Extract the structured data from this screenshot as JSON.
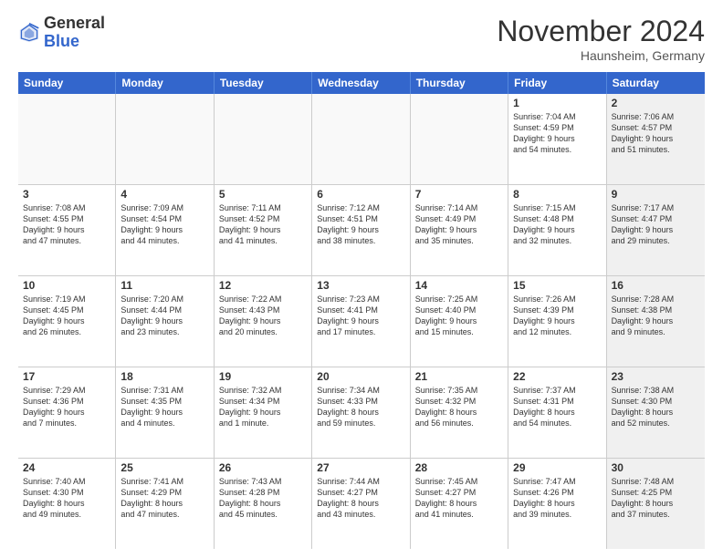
{
  "header": {
    "logo_general": "General",
    "logo_blue": "Blue",
    "month_title": "November 2024",
    "location": "Haunsheim, Germany"
  },
  "days_of_week": [
    "Sunday",
    "Monday",
    "Tuesday",
    "Wednesday",
    "Thursday",
    "Friday",
    "Saturday"
  ],
  "rows": [
    {
      "cells": [
        {
          "day": "",
          "info": "",
          "empty": true
        },
        {
          "day": "",
          "info": "",
          "empty": true
        },
        {
          "day": "",
          "info": "",
          "empty": true
        },
        {
          "day": "",
          "info": "",
          "empty": true
        },
        {
          "day": "",
          "info": "",
          "empty": true
        },
        {
          "day": "1",
          "info": "Sunrise: 7:04 AM\nSunset: 4:59 PM\nDaylight: 9 hours\nand 54 minutes.",
          "empty": false,
          "shaded": false
        },
        {
          "day": "2",
          "info": "Sunrise: 7:06 AM\nSunset: 4:57 PM\nDaylight: 9 hours\nand 51 minutes.",
          "empty": false,
          "shaded": true
        }
      ]
    },
    {
      "cells": [
        {
          "day": "3",
          "info": "Sunrise: 7:08 AM\nSunset: 4:55 PM\nDaylight: 9 hours\nand 47 minutes.",
          "empty": false,
          "shaded": false
        },
        {
          "day": "4",
          "info": "Sunrise: 7:09 AM\nSunset: 4:54 PM\nDaylight: 9 hours\nand 44 minutes.",
          "empty": false,
          "shaded": false
        },
        {
          "day": "5",
          "info": "Sunrise: 7:11 AM\nSunset: 4:52 PM\nDaylight: 9 hours\nand 41 minutes.",
          "empty": false,
          "shaded": false
        },
        {
          "day": "6",
          "info": "Sunrise: 7:12 AM\nSunset: 4:51 PM\nDaylight: 9 hours\nand 38 minutes.",
          "empty": false,
          "shaded": false
        },
        {
          "day": "7",
          "info": "Sunrise: 7:14 AM\nSunset: 4:49 PM\nDaylight: 9 hours\nand 35 minutes.",
          "empty": false,
          "shaded": false
        },
        {
          "day": "8",
          "info": "Sunrise: 7:15 AM\nSunset: 4:48 PM\nDaylight: 9 hours\nand 32 minutes.",
          "empty": false,
          "shaded": false
        },
        {
          "day": "9",
          "info": "Sunrise: 7:17 AM\nSunset: 4:47 PM\nDaylight: 9 hours\nand 29 minutes.",
          "empty": false,
          "shaded": true
        }
      ]
    },
    {
      "cells": [
        {
          "day": "10",
          "info": "Sunrise: 7:19 AM\nSunset: 4:45 PM\nDaylight: 9 hours\nand 26 minutes.",
          "empty": false,
          "shaded": false
        },
        {
          "day": "11",
          "info": "Sunrise: 7:20 AM\nSunset: 4:44 PM\nDaylight: 9 hours\nand 23 minutes.",
          "empty": false,
          "shaded": false
        },
        {
          "day": "12",
          "info": "Sunrise: 7:22 AM\nSunset: 4:43 PM\nDaylight: 9 hours\nand 20 minutes.",
          "empty": false,
          "shaded": false
        },
        {
          "day": "13",
          "info": "Sunrise: 7:23 AM\nSunset: 4:41 PM\nDaylight: 9 hours\nand 17 minutes.",
          "empty": false,
          "shaded": false
        },
        {
          "day": "14",
          "info": "Sunrise: 7:25 AM\nSunset: 4:40 PM\nDaylight: 9 hours\nand 15 minutes.",
          "empty": false,
          "shaded": false
        },
        {
          "day": "15",
          "info": "Sunrise: 7:26 AM\nSunset: 4:39 PM\nDaylight: 9 hours\nand 12 minutes.",
          "empty": false,
          "shaded": false
        },
        {
          "day": "16",
          "info": "Sunrise: 7:28 AM\nSunset: 4:38 PM\nDaylight: 9 hours\nand 9 minutes.",
          "empty": false,
          "shaded": true
        }
      ]
    },
    {
      "cells": [
        {
          "day": "17",
          "info": "Sunrise: 7:29 AM\nSunset: 4:36 PM\nDaylight: 9 hours\nand 7 minutes.",
          "empty": false,
          "shaded": false
        },
        {
          "day": "18",
          "info": "Sunrise: 7:31 AM\nSunset: 4:35 PM\nDaylight: 9 hours\nand 4 minutes.",
          "empty": false,
          "shaded": false
        },
        {
          "day": "19",
          "info": "Sunrise: 7:32 AM\nSunset: 4:34 PM\nDaylight: 9 hours\nand 1 minute.",
          "empty": false,
          "shaded": false
        },
        {
          "day": "20",
          "info": "Sunrise: 7:34 AM\nSunset: 4:33 PM\nDaylight: 8 hours\nand 59 minutes.",
          "empty": false,
          "shaded": false
        },
        {
          "day": "21",
          "info": "Sunrise: 7:35 AM\nSunset: 4:32 PM\nDaylight: 8 hours\nand 56 minutes.",
          "empty": false,
          "shaded": false
        },
        {
          "day": "22",
          "info": "Sunrise: 7:37 AM\nSunset: 4:31 PM\nDaylight: 8 hours\nand 54 minutes.",
          "empty": false,
          "shaded": false
        },
        {
          "day": "23",
          "info": "Sunrise: 7:38 AM\nSunset: 4:30 PM\nDaylight: 8 hours\nand 52 minutes.",
          "empty": false,
          "shaded": true
        }
      ]
    },
    {
      "cells": [
        {
          "day": "24",
          "info": "Sunrise: 7:40 AM\nSunset: 4:30 PM\nDaylight: 8 hours\nand 49 minutes.",
          "empty": false,
          "shaded": false
        },
        {
          "day": "25",
          "info": "Sunrise: 7:41 AM\nSunset: 4:29 PM\nDaylight: 8 hours\nand 47 minutes.",
          "empty": false,
          "shaded": false
        },
        {
          "day": "26",
          "info": "Sunrise: 7:43 AM\nSunset: 4:28 PM\nDaylight: 8 hours\nand 45 minutes.",
          "empty": false,
          "shaded": false
        },
        {
          "day": "27",
          "info": "Sunrise: 7:44 AM\nSunset: 4:27 PM\nDaylight: 8 hours\nand 43 minutes.",
          "empty": false,
          "shaded": false
        },
        {
          "day": "28",
          "info": "Sunrise: 7:45 AM\nSunset: 4:27 PM\nDaylight: 8 hours\nand 41 minutes.",
          "empty": false,
          "shaded": false
        },
        {
          "day": "29",
          "info": "Sunrise: 7:47 AM\nSunset: 4:26 PM\nDaylight: 8 hours\nand 39 minutes.",
          "empty": false,
          "shaded": false
        },
        {
          "day": "30",
          "info": "Sunrise: 7:48 AM\nSunset: 4:25 PM\nDaylight: 8 hours\nand 37 minutes.",
          "empty": false,
          "shaded": true
        }
      ]
    }
  ]
}
